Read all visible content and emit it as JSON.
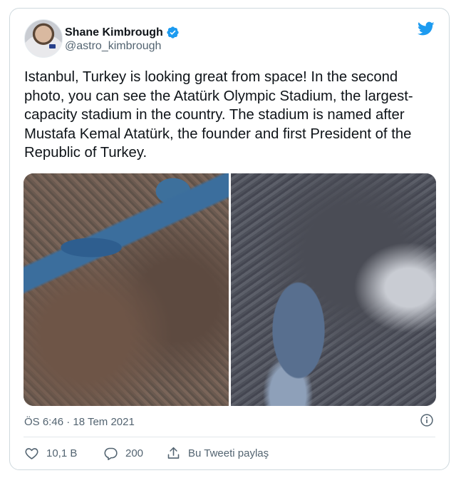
{
  "tweet": {
    "author_name": "Shane Kimbrough",
    "author_handle": "@astro_kimbrough",
    "text": "Istanbul, Turkey is looking great from space! In the second photo, you can see the Atatürk Olympic Stadium, the largest-capacity stadium in the country. The stadium is named after Mustafa Kemal Atatürk, the founder and first President of the Republic of Turkey.",
    "timestamp": "ÖS 6:46 · 18 Tem 2021",
    "media_count": 2
  },
  "actions": {
    "likes": "10,1 B",
    "replies": "200",
    "share_label": "Bu Tweeti paylaş"
  },
  "icons": {
    "brand": "twitter-bird-icon",
    "verified": "verified-badge-icon",
    "info": "info-icon",
    "like": "heart-icon",
    "reply": "reply-icon",
    "share": "share-icon"
  },
  "colors": {
    "twitter_blue": "#1d9bf0",
    "text": "#0f1419",
    "secondary_text": "#536471",
    "border": "#cfd9de"
  }
}
